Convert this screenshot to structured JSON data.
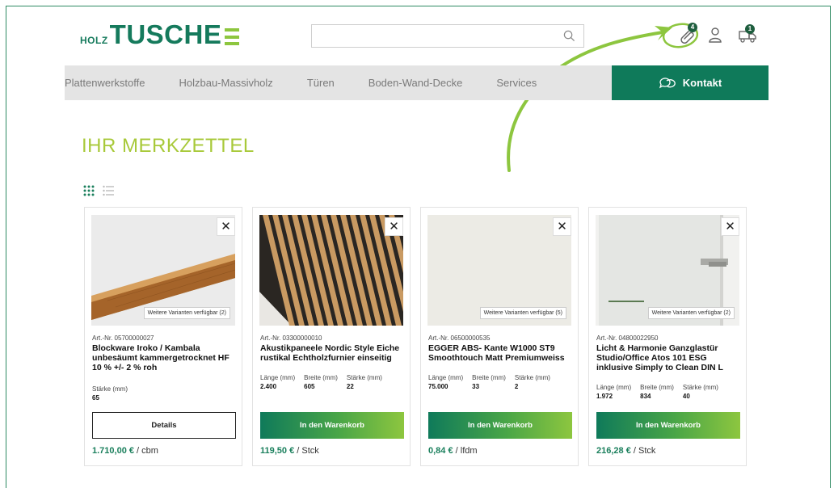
{
  "header": {
    "logo_prefix": "HOLZ",
    "logo_main": "TUSCHE",
    "search_placeholder": "",
    "wishlist_count": "4",
    "cart_count": "1"
  },
  "nav": {
    "items": [
      "Plattenwerkstoffe",
      "Holzbau-Massivholz",
      "Türen",
      "Boden-Wand-Decke",
      "Services"
    ],
    "kontakt_label": "Kontakt"
  },
  "page_title": "IHR MERKZETTEL",
  "products": [
    {
      "art": "Art.-Nr. 05700000027",
      "name": "Blockware Iroko / Kambala unbesäumt kammergetrocknet HF 10 % +/- 2 % roh",
      "variants": "Weitere Varianten verfügbar (2)",
      "specs": [
        {
          "label": "Stärke (mm)",
          "value": "65"
        }
      ],
      "button": "Details",
      "price": "1.710,00 €",
      "unit": " / cbm"
    },
    {
      "art": "Art.-Nr. 03300000010",
      "name": "Akustikpaneele Nordic Style Eiche rustikal Echtholzfurnier einseitig",
      "variants": "",
      "specs": [
        {
          "label": "Länge (mm)",
          "value": "2.400"
        },
        {
          "label": "Breite (mm)",
          "value": "605"
        },
        {
          "label": "Stärke (mm)",
          "value": "22"
        }
      ],
      "button": "In den Warenkorb",
      "price": "119,50 €",
      "unit": " / Stck"
    },
    {
      "art": "Art.-Nr. 06500000535",
      "name": "EGGER ABS- Kante W1000 ST9 Smoothtouch Matt Premiumweiss",
      "variants": "Weitere Varianten verfügbar (5)",
      "specs": [
        {
          "label": "Länge (mm)",
          "value": "75.000"
        },
        {
          "label": "Breite (mm)",
          "value": "33"
        },
        {
          "label": "Stärke (mm)",
          "value": "2"
        }
      ],
      "button": "In den Warenkorb",
      "price": "0,84 €",
      "unit": " / lfdm"
    },
    {
      "art": "Art.-Nr. 04800022950",
      "name": "Licht & Harmonie Ganzglastür Studio/Office Atos 101 ESG inklusive Simply to Clean DIN L",
      "variants": "Weitere Varianten verfügbar (2)",
      "specs": [
        {
          "label": "Länge (mm)",
          "value": "1.972"
        },
        {
          "label": "Breite (mm)",
          "value": "834"
        },
        {
          "label": "Stärke (mm)",
          "value": "40"
        }
      ],
      "button": "In den Warenkorb",
      "price": "216,28 €",
      "unit": " / Stck"
    }
  ],
  "close_glyph": "✕",
  "colors": {
    "brand_green": "#0f7a5a",
    "lime": "#8dc63f",
    "title_lime": "#a8c93a",
    "nav_bg": "#e4e4e4"
  }
}
